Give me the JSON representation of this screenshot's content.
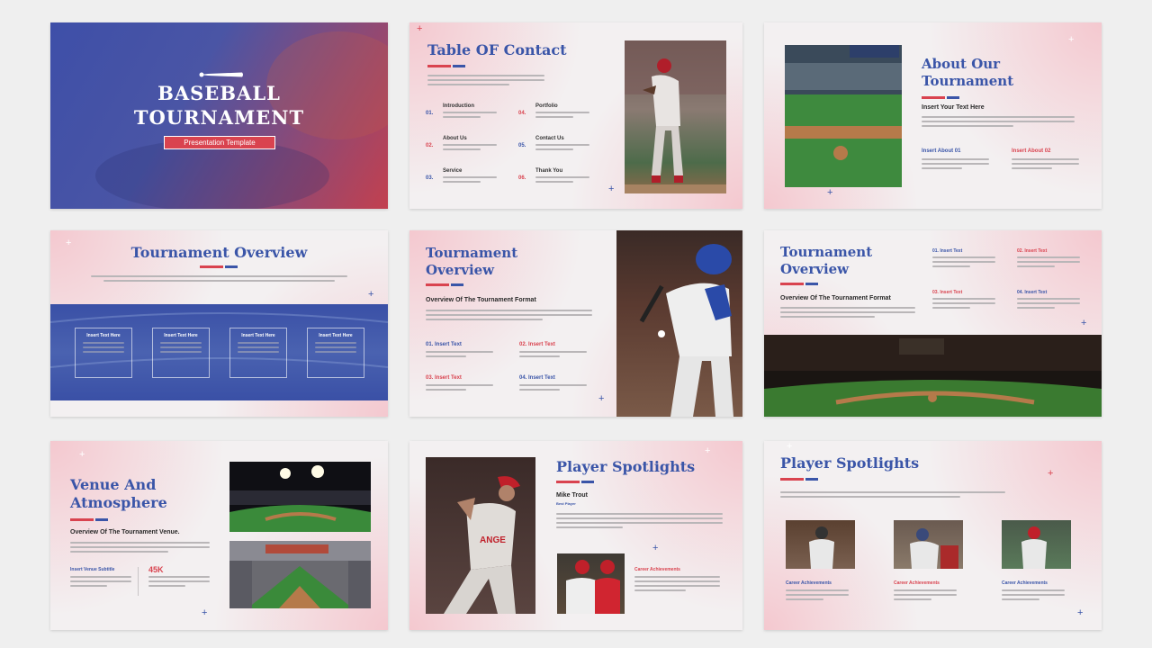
{
  "slide1": {
    "title_line1": "BASEBALL",
    "title_line2": "TOURNAMENT",
    "subtitle": "Presentation Template"
  },
  "slide2": {
    "title": "Table OF Contact",
    "items": [
      {
        "num": "01.",
        "label": "Introduction"
      },
      {
        "num": "04.",
        "label": "Portfolio"
      },
      {
        "num": "02.",
        "label": "About Us"
      },
      {
        "num": "05.",
        "label": "Contact Us"
      },
      {
        "num": "03.",
        "label": "Service"
      },
      {
        "num": "06.",
        "label": "Thank You"
      }
    ]
  },
  "slide3": {
    "title_line1": "About Our",
    "title_line2": "Tournament",
    "subtitle": "Insert Your Text Here",
    "about1": "Insert About 01",
    "about2": "Insert About 02"
  },
  "slide4": {
    "title": "Tournament Overview",
    "boxes": [
      "Insert Text Here",
      "Insert Text Here",
      "Insert Text Here",
      "Insert Text Here"
    ]
  },
  "slide5": {
    "title_line1": "Tournament",
    "title_line2": "Overview",
    "subtitle": "Overview Of The Tournament Format",
    "items": [
      "01. Insert Text",
      "02. Insert Text",
      "03. Insert Text",
      "04. Insert Text"
    ]
  },
  "slide6": {
    "title_line1": "Tournament",
    "title_line2": "Overview",
    "subtitle": "Overview Of The Tournament Format",
    "items": [
      "01. Insert Text",
      "02. Insert Text",
      "03. Insert Text",
      "04. Insert Text"
    ]
  },
  "slide7": {
    "title_line1": "Venue And",
    "title_line2": "Atmosphere",
    "subtitle": "Overview Of The Tournament Venue.",
    "venue_label": "Insert Venue Subtitle",
    "stat": "45K"
  },
  "slide8": {
    "title": "Player Spotlights",
    "player_name": "Mike Trout",
    "player_role": "Best Player",
    "achievements": "Career Achievements"
  },
  "slide9": {
    "title": "Player Spotlights",
    "cards": [
      "Career Achievements",
      "Career Achievements",
      "Career Achievements"
    ]
  },
  "colors": {
    "blue": "#3a55a8",
    "red": "#d9434f",
    "background": "#efefef"
  }
}
